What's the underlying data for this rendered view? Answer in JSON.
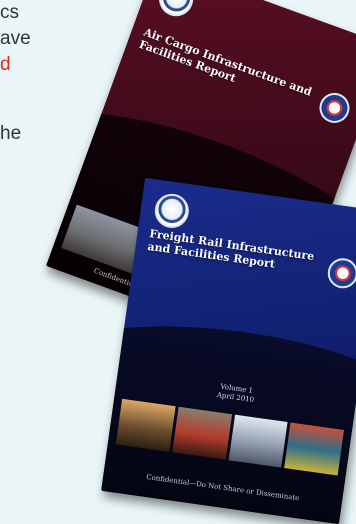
{
  "background_text": {
    "line1": "cs",
    "line2": "ave",
    "line3_red": "d",
    "line4": "he"
  },
  "covers": {
    "air_cargo": {
      "title": "Air Cargo Infrastructure and Facilities Report",
      "confidential": "Confidential—Do Not Share or Disseminate"
    },
    "freight_rail": {
      "title": "Freight Rail Infrastructure and Facilities Report",
      "volume": "Volume 1",
      "date": "April 2010",
      "confidential": "Confidential—Do Not Share or Disseminate"
    }
  },
  "colors": {
    "air_cargo_cover": "#5b0e24",
    "freight_rail_cover": "#1a2c8c",
    "accent_red": "#e32a22",
    "page_background": "#e9f5f7"
  }
}
